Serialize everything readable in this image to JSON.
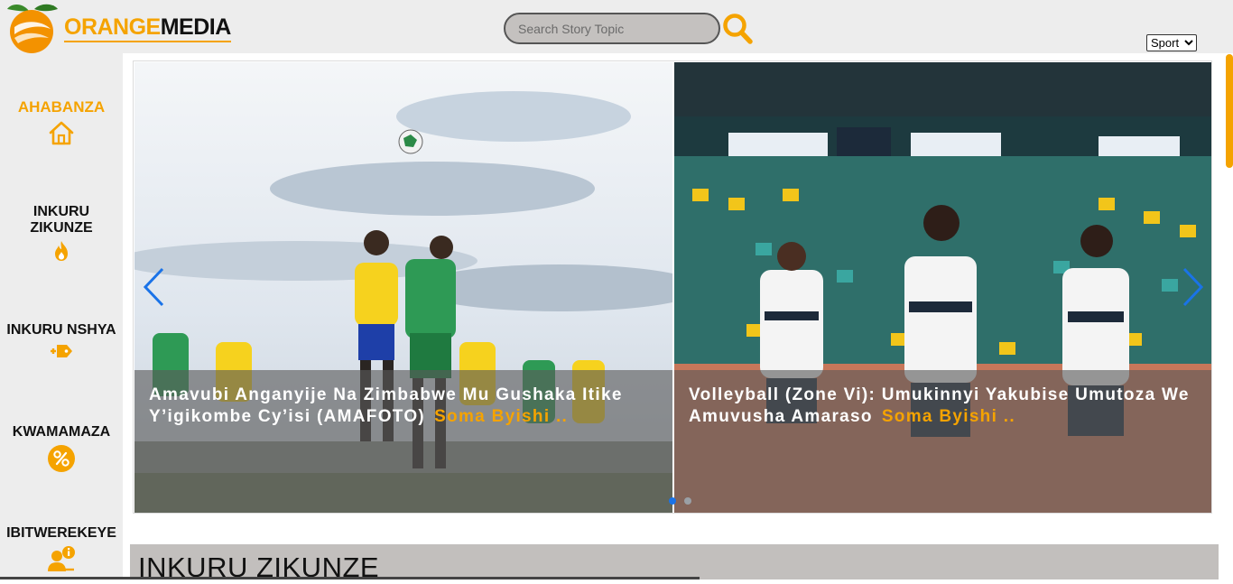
{
  "header": {
    "brand_orange": "ORANGE",
    "brand_media": "MEDIA",
    "search_placeholder": "Search Story Topic",
    "category_selected": "Sport"
  },
  "sidebar": {
    "items": [
      {
        "label": "AHABANZA",
        "icon": "home-icon",
        "active": true
      },
      {
        "label": "INKURU ZIKUNZE",
        "icon": "fire-icon",
        "active": false
      },
      {
        "label": "INKURU NSHYA",
        "icon": "new-tag-icon",
        "active": false
      },
      {
        "label": "KWAMAMAZA",
        "icon": "megaphone-icon",
        "active": false
      },
      {
        "label": "IBITWEREKEYE",
        "icon": "about-user-icon",
        "active": false
      }
    ]
  },
  "carousel": {
    "slides": [
      {
        "title": "Amavubi Anganyije Na Zimbabwe Mu Gushaka Itike Y’igikombe Cy’isi (AMAFOTO)",
        "read_more": "Soma Byishi ..",
        "image": "football-match-photo"
      },
      {
        "title": "Volleyball (Zone Vi): Umukinnyi Yakubise Umutoza We Amuvusha Amaraso",
        "read_more": "Soma Byishi ..",
        "image": "volleyball-players-photo"
      }
    ],
    "active_index": 0,
    "slide_count": 2
  },
  "section": {
    "title": "INKURU ZIKUNZE"
  },
  "colors": {
    "accent": "#f5a300",
    "header_bg": "#ededed",
    "section_bg": "#c2bfbd",
    "carousel_dot": "#1a73e8"
  }
}
